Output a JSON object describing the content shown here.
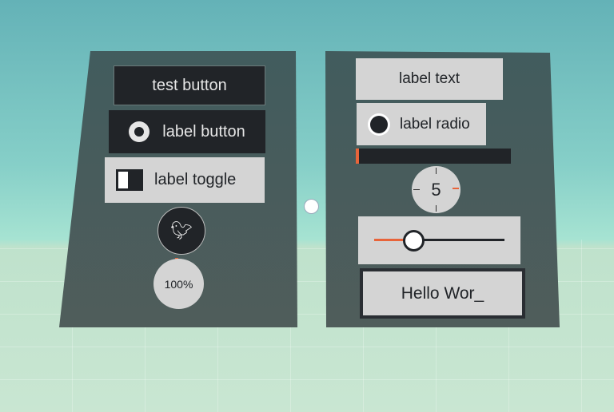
{
  "left_panel": {
    "test_button": "test button",
    "label_button": "label button",
    "label_button_icon": "github-icon",
    "label_toggle": "label toggle",
    "toggle_on": false,
    "icon_button_icon": "twitter-icon",
    "progress_label": "100%",
    "progress_value": 1.0
  },
  "right_panel": {
    "label_text": "label text",
    "label_radio": "label radio",
    "radio_checked": true,
    "progress_bar_value": 0.02,
    "dial_value": "5",
    "slider_value": 0.3,
    "input_value": "Hello Wor_"
  },
  "colors": {
    "accent": "#e8643a",
    "dark": "#212428",
    "light": "#d4d4d4"
  }
}
